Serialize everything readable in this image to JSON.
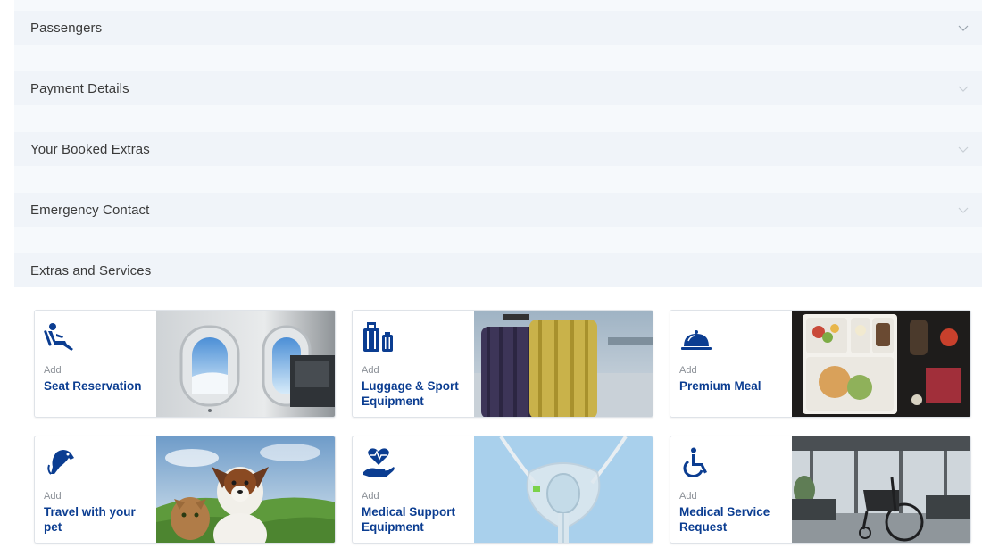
{
  "accordion": [
    {
      "label": "Passengers"
    },
    {
      "label": "Payment Details"
    },
    {
      "label": "Your Booked Extras"
    },
    {
      "label": "Emergency Contact"
    },
    {
      "label": "Extras and Services"
    }
  ],
  "extras": {
    "add_label": "Add",
    "cards": [
      {
        "title": "Seat Reservation",
        "icon": "seat-icon",
        "image": "airplane-window-image"
      },
      {
        "title": "Luggage & Sport Equipment",
        "icon": "luggage-icon",
        "image": "suitcases-image"
      },
      {
        "title": "Premium Meal",
        "icon": "cloche-icon",
        "image": "meal-tray-image"
      },
      {
        "title": "Travel with your pet",
        "icon": "pet-icon",
        "image": "dog-and-cat-image"
      },
      {
        "title": "Medical Support Equipment",
        "icon": "heart-hand-icon",
        "image": "oxygen-mask-image"
      },
      {
        "title": "Medical Service Request",
        "icon": "wheelchair-icon",
        "image": "wheelchair-airport-image"
      }
    ]
  },
  "colors": {
    "brand_blue": "#0b3d91",
    "panel_bg": "#f0f4f9",
    "card_border": "#dfe3e8"
  }
}
